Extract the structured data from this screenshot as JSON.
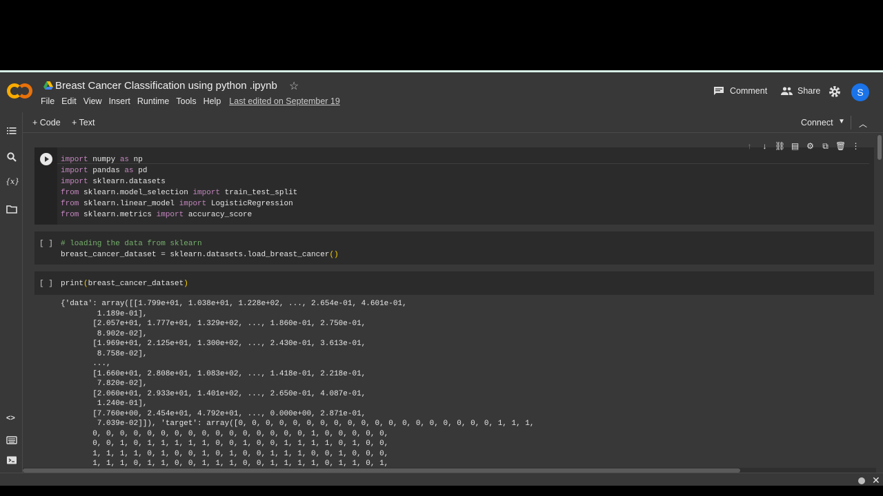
{
  "header": {
    "title": "Breast Cancer Classification using python .ipynb",
    "menu": [
      "File",
      "Edit",
      "View",
      "Insert",
      "Runtime",
      "Tools",
      "Help"
    ],
    "last_edited": "Last edited on September 19",
    "comment_label": "Comment",
    "share_label": "Share",
    "avatar_letter": "S"
  },
  "toolbar": {
    "add_code": "+ Code",
    "add_text": "+ Text",
    "connect": "Connect"
  },
  "cells": {
    "cell1": {
      "lines": [
        [
          "import",
          " numpy ",
          "as",
          " np"
        ],
        [
          "import",
          " pandas ",
          "as",
          " pd"
        ],
        [
          "import",
          " sklearn.datasets",
          "",
          ""
        ],
        [
          "from",
          " sklearn.model_selection ",
          "import",
          " train_test_split"
        ],
        [
          "from",
          " sklearn.linear_model ",
          "import",
          " LogisticRegression"
        ],
        [
          "from",
          " sklearn.metrics ",
          "import",
          " accuracy_score"
        ]
      ]
    },
    "cell2": {
      "bracket": "[ ]",
      "comment": "# loading the data from sklearn",
      "code": "breast_cancer_dataset = sklearn.datasets.load_breast_cancer",
      "parens": "()"
    },
    "cell3": {
      "bracket": "[ ]",
      "code": "print",
      "parens_open": "(",
      "arg": "breast_cancer_dataset",
      "parens_close": ")"
    }
  },
  "output": {
    "text": "{'data': array([[1.799e+01, 1.038e+01, 1.228e+02, ..., 2.654e-01, 4.601e-01,\n        1.189e-01],\n       [2.057e+01, 1.777e+01, 1.329e+02, ..., 1.860e-01, 2.750e-01,\n        8.902e-02],\n       [1.969e+01, 2.125e+01, 1.300e+02, ..., 2.430e-01, 3.613e-01,\n        8.758e-02],\n       ...,\n       [1.660e+01, 2.808e+01, 1.083e+02, ..., 1.418e-01, 2.218e-01,\n        7.820e-02],\n       [2.060e+01, 2.933e+01, 1.401e+02, ..., 2.650e-01, 4.087e-01,\n        1.240e-01],\n       [7.760e+00, 2.454e+01, 4.792e+01, ..., 0.000e+00, 2.871e-01,\n        7.039e-02]]), 'target': array([0, 0, 0, 0, 0, 0, 0, 0, 0, 0, 0, 0, 0, 0, 0, 0, 0, 0, 0, 1, 1, 1,\n       0, 0, 0, 0, 0, 0, 0, 0, 0, 0, 0, 0, 0, 0, 0, 0, 1, 0, 0, 0, 0, 0,\n       0, 0, 1, 0, 1, 1, 1, 1, 1, 0, 0, 1, 0, 0, 1, 1, 1, 1, 0, 1, 0, 0,\n       1, 1, 1, 1, 0, 1, 0, 0, 1, 0, 1, 0, 0, 1, 1, 1, 0, 0, 1, 0, 0, 0,\n       1, 1, 1, 0, 1, 1, 0, 0, 1, 1, 1, 0, 0, 1, 1, 1, 1, 0, 1, 1, 0, 1,"
  },
  "icons": {
    "sidebar": [
      "toc-icon",
      "search-icon",
      "variables-icon",
      "folder-icon",
      "code-snippets-icon",
      "command-palette-icon",
      "terminal-icon"
    ],
    "cell_toolbar": [
      "move-up-icon",
      "move-down-icon",
      "link-icon",
      "comment-icon",
      "settings-icon",
      "mirror-icon",
      "delete-icon",
      "more-icon"
    ]
  },
  "colors": {
    "background": "#383838",
    "cell_background": "#2b2b2b",
    "keyword": "#c586c0",
    "comment": "#76b06c",
    "paren": "#ffd500",
    "avatar": "#1a73e8"
  }
}
